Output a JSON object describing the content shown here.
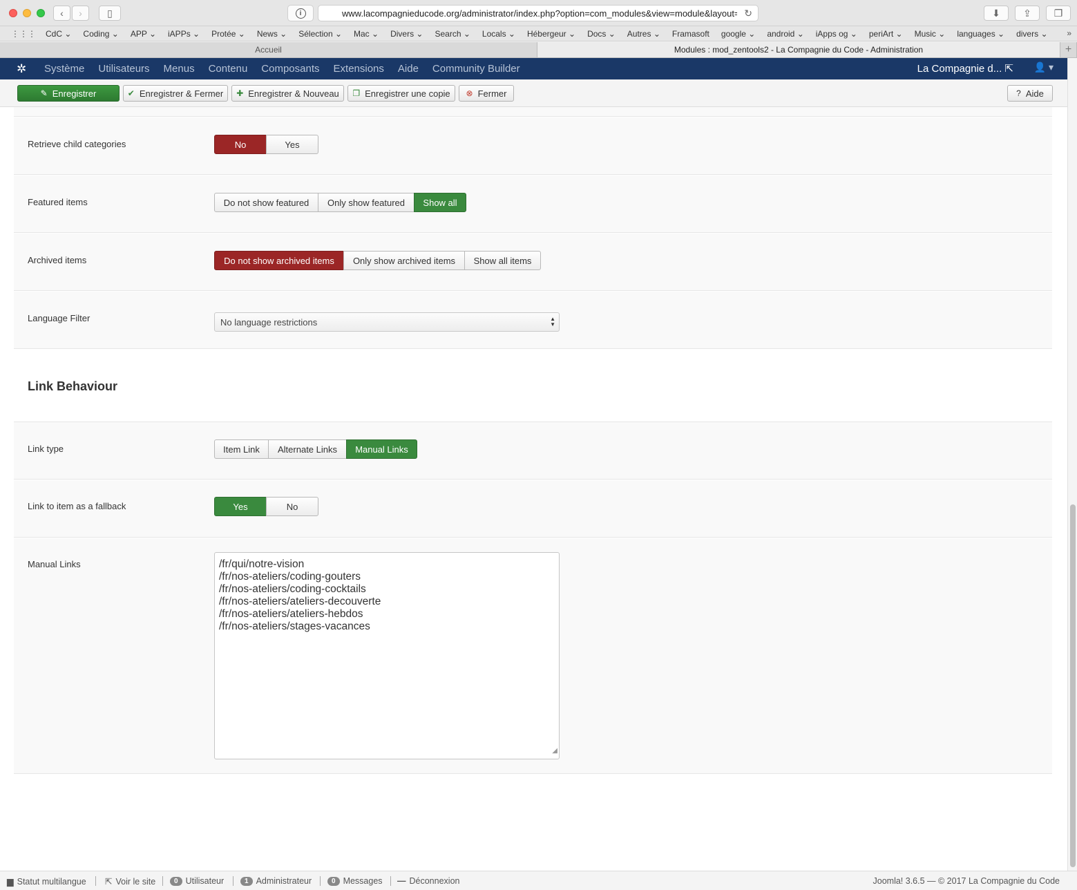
{
  "browser": {
    "url": "www.lacompagnieducode.org/administrator/index.php?option=com_modules&view=module&layout=e",
    "bookmarks": [
      "CdC",
      "Coding",
      "APP",
      "iAPPs",
      "Protée",
      "News",
      "Sélection",
      "Mac",
      "Divers",
      "Search",
      "Locals",
      "Hébergeur",
      "Docs",
      "Autres",
      "Framasoft",
      "google",
      "android",
      "iApps og",
      "periArt",
      "Music",
      "languages",
      "divers"
    ],
    "bookmark_dropdowns": [
      true,
      true,
      true,
      true,
      true,
      true,
      true,
      true,
      true,
      true,
      true,
      true,
      true,
      true,
      false,
      true,
      true,
      true,
      true,
      true,
      true,
      true
    ],
    "tabs": [
      {
        "label": "Accueil",
        "active": false
      },
      {
        "label": "Modules : mod_zentools2 - La Compagnie du Code - Administration",
        "active": true
      }
    ]
  },
  "header": {
    "menu": [
      "Système",
      "Utilisateurs",
      "Menus",
      "Contenu",
      "Composants",
      "Extensions",
      "Aide",
      "Community Builder"
    ],
    "site_name": "La Compagnie d...",
    "brand_color": "#1a3867"
  },
  "toolbar": {
    "save": "Enregistrer",
    "save_close": "Enregistrer & Fermer",
    "save_new": "Enregistrer & Nouveau",
    "save_copy": "Enregistrer une copie",
    "close": "Fermer",
    "help": "Aide"
  },
  "fields": {
    "child_categories": {
      "label": "Retrieve child categories",
      "options": [
        "No",
        "Yes"
      ],
      "selected": "No"
    },
    "featured": {
      "label": "Featured items",
      "options": [
        "Do not show featured",
        "Only show featured",
        "Show all"
      ],
      "selected": "Show all"
    },
    "archived": {
      "label": "Archived items",
      "options": [
        "Do not show archived items",
        "Only show archived items",
        "Show all items"
      ],
      "selected": "Do not show archived items"
    },
    "language": {
      "label": "Language Filter",
      "value": "No language restrictions"
    },
    "link_section_title": "Link Behaviour",
    "link_type": {
      "label": "Link type",
      "options": [
        "Item Link",
        "Alternate Links",
        "Manual Links"
      ],
      "selected": "Manual Links"
    },
    "fallback": {
      "label": "Link to item as a fallback",
      "options": [
        "Yes",
        "No"
      ],
      "selected": "Yes"
    },
    "manual_links": {
      "label": "Manual Links",
      "lines": [
        "/fr/qui/notre-vision",
        "/fr/nos-ateliers/coding-gouters",
        "/fr/nos-ateliers/coding-cocktails",
        "/fr/nos-ateliers/ateliers-decouverte",
        "/fr/nos-ateliers/ateliers-hebdos",
        "/fr/nos-ateliers/stages-vacances"
      ]
    }
  },
  "status": {
    "multilang": "Statut multilangue",
    "view_site": "Voir le site",
    "users_count": "0",
    "users_label": "Utilisateur",
    "admins_count": "1",
    "admins_label": "Administrateur",
    "messages_count": "0",
    "messages_label": "Messages",
    "logout": "Déconnexion",
    "footer": "Joomla! 3.6.5  —  © 2017 La Compagnie du Code"
  },
  "colors": {
    "selected_red": "#9b2626",
    "selected_green": "#3a8a3e"
  }
}
